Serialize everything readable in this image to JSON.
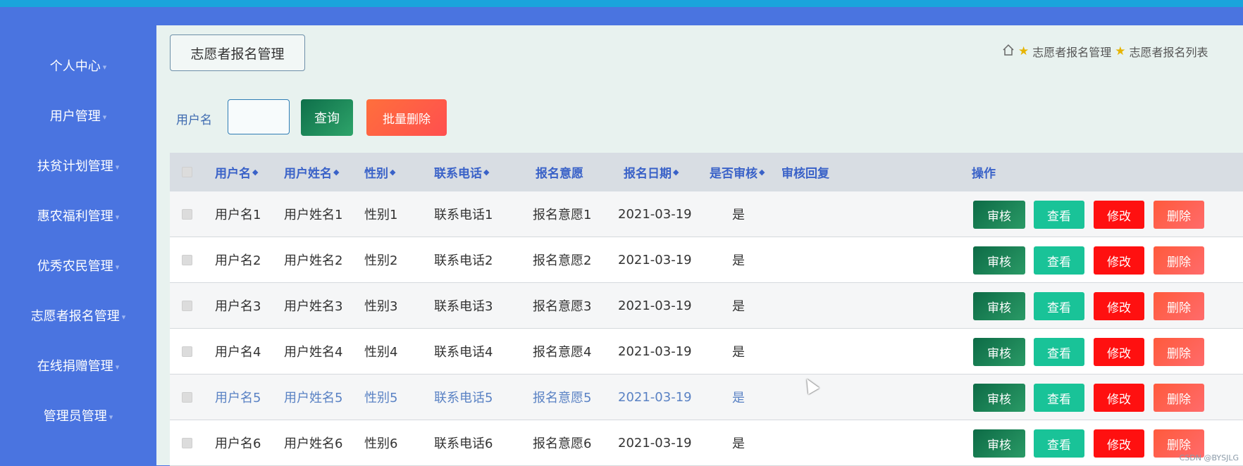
{
  "sidebar": {
    "items": [
      {
        "label": "个人中心"
      },
      {
        "label": "用户管理"
      },
      {
        "label": "扶贫计划管理"
      },
      {
        "label": "惠农福利管理"
      },
      {
        "label": "优秀农民管理"
      },
      {
        "label": "志愿者报名管理"
      },
      {
        "label": "在线捐赠管理"
      },
      {
        "label": "管理员管理"
      }
    ]
  },
  "header": {
    "page_title": "志愿者报名管理",
    "breadcrumb": [
      "志愿者报名管理",
      "志愿者报名列表"
    ]
  },
  "search": {
    "label": "用户名",
    "value": "",
    "query_button": "查询",
    "batch_delete_button": "批量删除"
  },
  "table": {
    "columns": [
      "用户名",
      "用户姓名",
      "性别",
      "联系电话",
      "报名意愿",
      "报名日期",
      "是否审核",
      "审核回复",
      "操作"
    ],
    "rows": [
      {
        "username": "用户名1",
        "name": "用户姓名1",
        "gender": "性别1",
        "phone": "联系电话1",
        "intent": "报名意愿1",
        "date": "2021-03-19",
        "reviewed": "是",
        "reply": ""
      },
      {
        "username": "用户名2",
        "name": "用户姓名2",
        "gender": "性别2",
        "phone": "联系电话2",
        "intent": "报名意愿2",
        "date": "2021-03-19",
        "reviewed": "是",
        "reply": ""
      },
      {
        "username": "用户名3",
        "name": "用户姓名3",
        "gender": "性别3",
        "phone": "联系电话3",
        "intent": "报名意愿3",
        "date": "2021-03-19",
        "reviewed": "是",
        "reply": ""
      },
      {
        "username": "用户名4",
        "name": "用户姓名4",
        "gender": "性别4",
        "phone": "联系电话4",
        "intent": "报名意愿4",
        "date": "2021-03-19",
        "reviewed": "是",
        "reply": ""
      },
      {
        "username": "用户名5",
        "name": "用户姓名5",
        "gender": "性别5",
        "phone": "联系电话5",
        "intent": "报名意愿5",
        "date": "2021-03-19",
        "reviewed": "是",
        "reply": ""
      },
      {
        "username": "用户名6",
        "name": "用户姓名6",
        "gender": "性别6",
        "phone": "联系电话6",
        "intent": "报名意愿6",
        "date": "2021-03-19",
        "reviewed": "是",
        "reply": ""
      }
    ],
    "actions": {
      "review": "审核",
      "view": "查看",
      "edit": "修改",
      "delete": "删除"
    }
  },
  "watermark": "CSDN @BYSJLG",
  "colors": {
    "sidebar": "#4a74e0",
    "topbar": "#1aa4dc",
    "content_bg": "#e8f2ef",
    "header_text": "#3a62c8"
  }
}
